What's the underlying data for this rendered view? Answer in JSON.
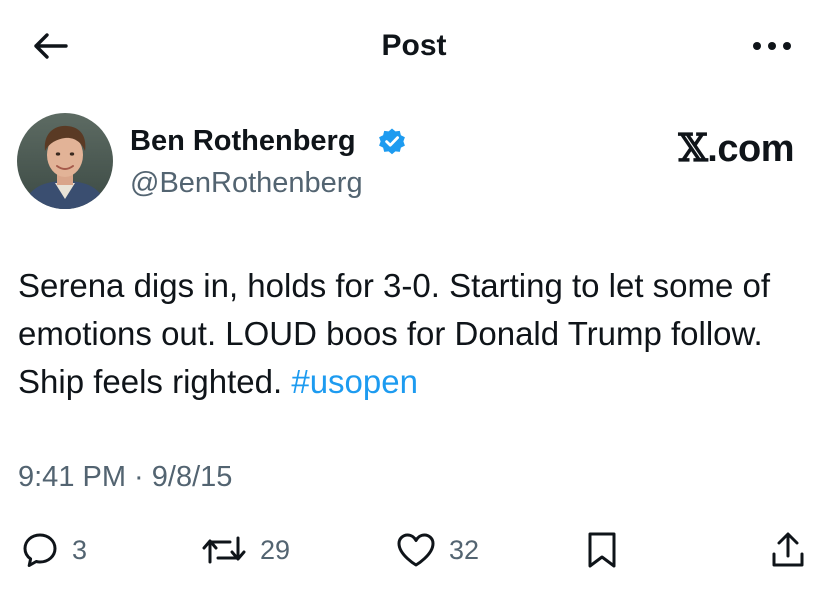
{
  "header": {
    "title": "Post",
    "back_icon": "arrow-left-icon",
    "more_icon": "more-horizontal-icon"
  },
  "author": {
    "name": "Ben Rothenberg",
    "handle": "@BenRothenberg",
    "verified": true,
    "verified_color": "#1d9bf0"
  },
  "brand": {
    "x_glyph": "𝕏",
    "suffix": ".com"
  },
  "post": {
    "text": "Serena digs in, holds for 3-0. Starting to let some of emotions out. LOUD boos for Donald Trump follow. Ship feels righted. ",
    "hashtag": "#usopen",
    "hashtag_color": "#1d9bf0"
  },
  "meta": {
    "timestamp": "9:41 PM · 9/8/15"
  },
  "actions": {
    "replies": "3",
    "reposts": "29",
    "likes": "32"
  },
  "colors": {
    "text": "#0f1419",
    "secondary": "#536471",
    "accent": "#1d9bf0"
  }
}
